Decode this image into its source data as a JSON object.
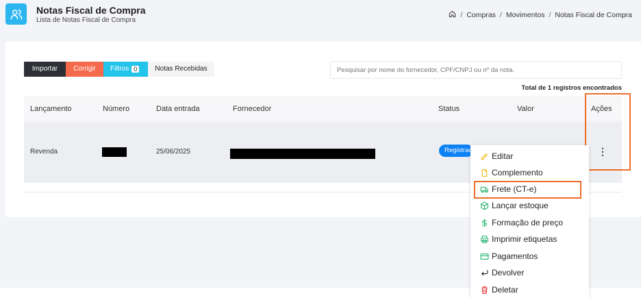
{
  "header": {
    "title": "Notas Fiscal de Compra",
    "subtitle": "Lista de Notas Fiscal de Compra",
    "icon": "users-icon",
    "breadcrumb": [
      "Compras",
      "Movimentos",
      "Notas Fiscal de Compra"
    ],
    "separator": "/"
  },
  "toolbar": {
    "importar": "Importar",
    "corrigir": "Corrigir",
    "filtros": "Filtros",
    "filtros_count": "0",
    "recebidas": "Notas Recebidas"
  },
  "search": {
    "placeholder": "Pesquisar por nome do fornecedor, CPF/CNPJ ou nº da nota."
  },
  "total": "Total de 1 registros encontrados",
  "table": {
    "columns": [
      "Lançamento",
      "Número",
      "Data entrada",
      "Fornecedor",
      "Status",
      "Valor",
      "Ações"
    ],
    "rows": [
      {
        "lancamento": "Revenda",
        "numero": "",
        "data_entrada": "25/06/2025",
        "fornecedor": "",
        "status": "Registrada",
        "valor": ""
      }
    ]
  },
  "actions_menu": {
    "trigger": "⋮",
    "items": [
      {
        "label": "Editar",
        "icon": "pencil-icon",
        "color": "#f2b705"
      },
      {
        "label": "Complemento",
        "icon": "file-icon",
        "color": "#f2b705"
      },
      {
        "label": "Frete (CT-e)",
        "icon": "truck-icon",
        "color": "#20b26b"
      },
      {
        "label": "Lançar estoque",
        "icon": "box-icon",
        "color": "#20b26b"
      },
      {
        "label": "Formação de preço",
        "icon": "dollar-icon",
        "color": "#20b26b"
      },
      {
        "label": "Imprimir etiquetas",
        "icon": "printer-icon",
        "color": "#20b26b"
      },
      {
        "label": "Pagamentos",
        "icon": "credit-card-icon",
        "color": "#20b26b"
      },
      {
        "label": "Devolver",
        "icon": "return-arrow-icon",
        "color": "#222222"
      },
      {
        "label": "Deletar",
        "icon": "trash-icon",
        "color": "#e53935"
      }
    ]
  },
  "colors": {
    "accent": "#2db5f0",
    "importar": "#2e3035",
    "corrigir": "#f56a4c",
    "filtros": "#22c4ea",
    "status": "#0d82f5",
    "highlight": "#ef6c2a"
  }
}
